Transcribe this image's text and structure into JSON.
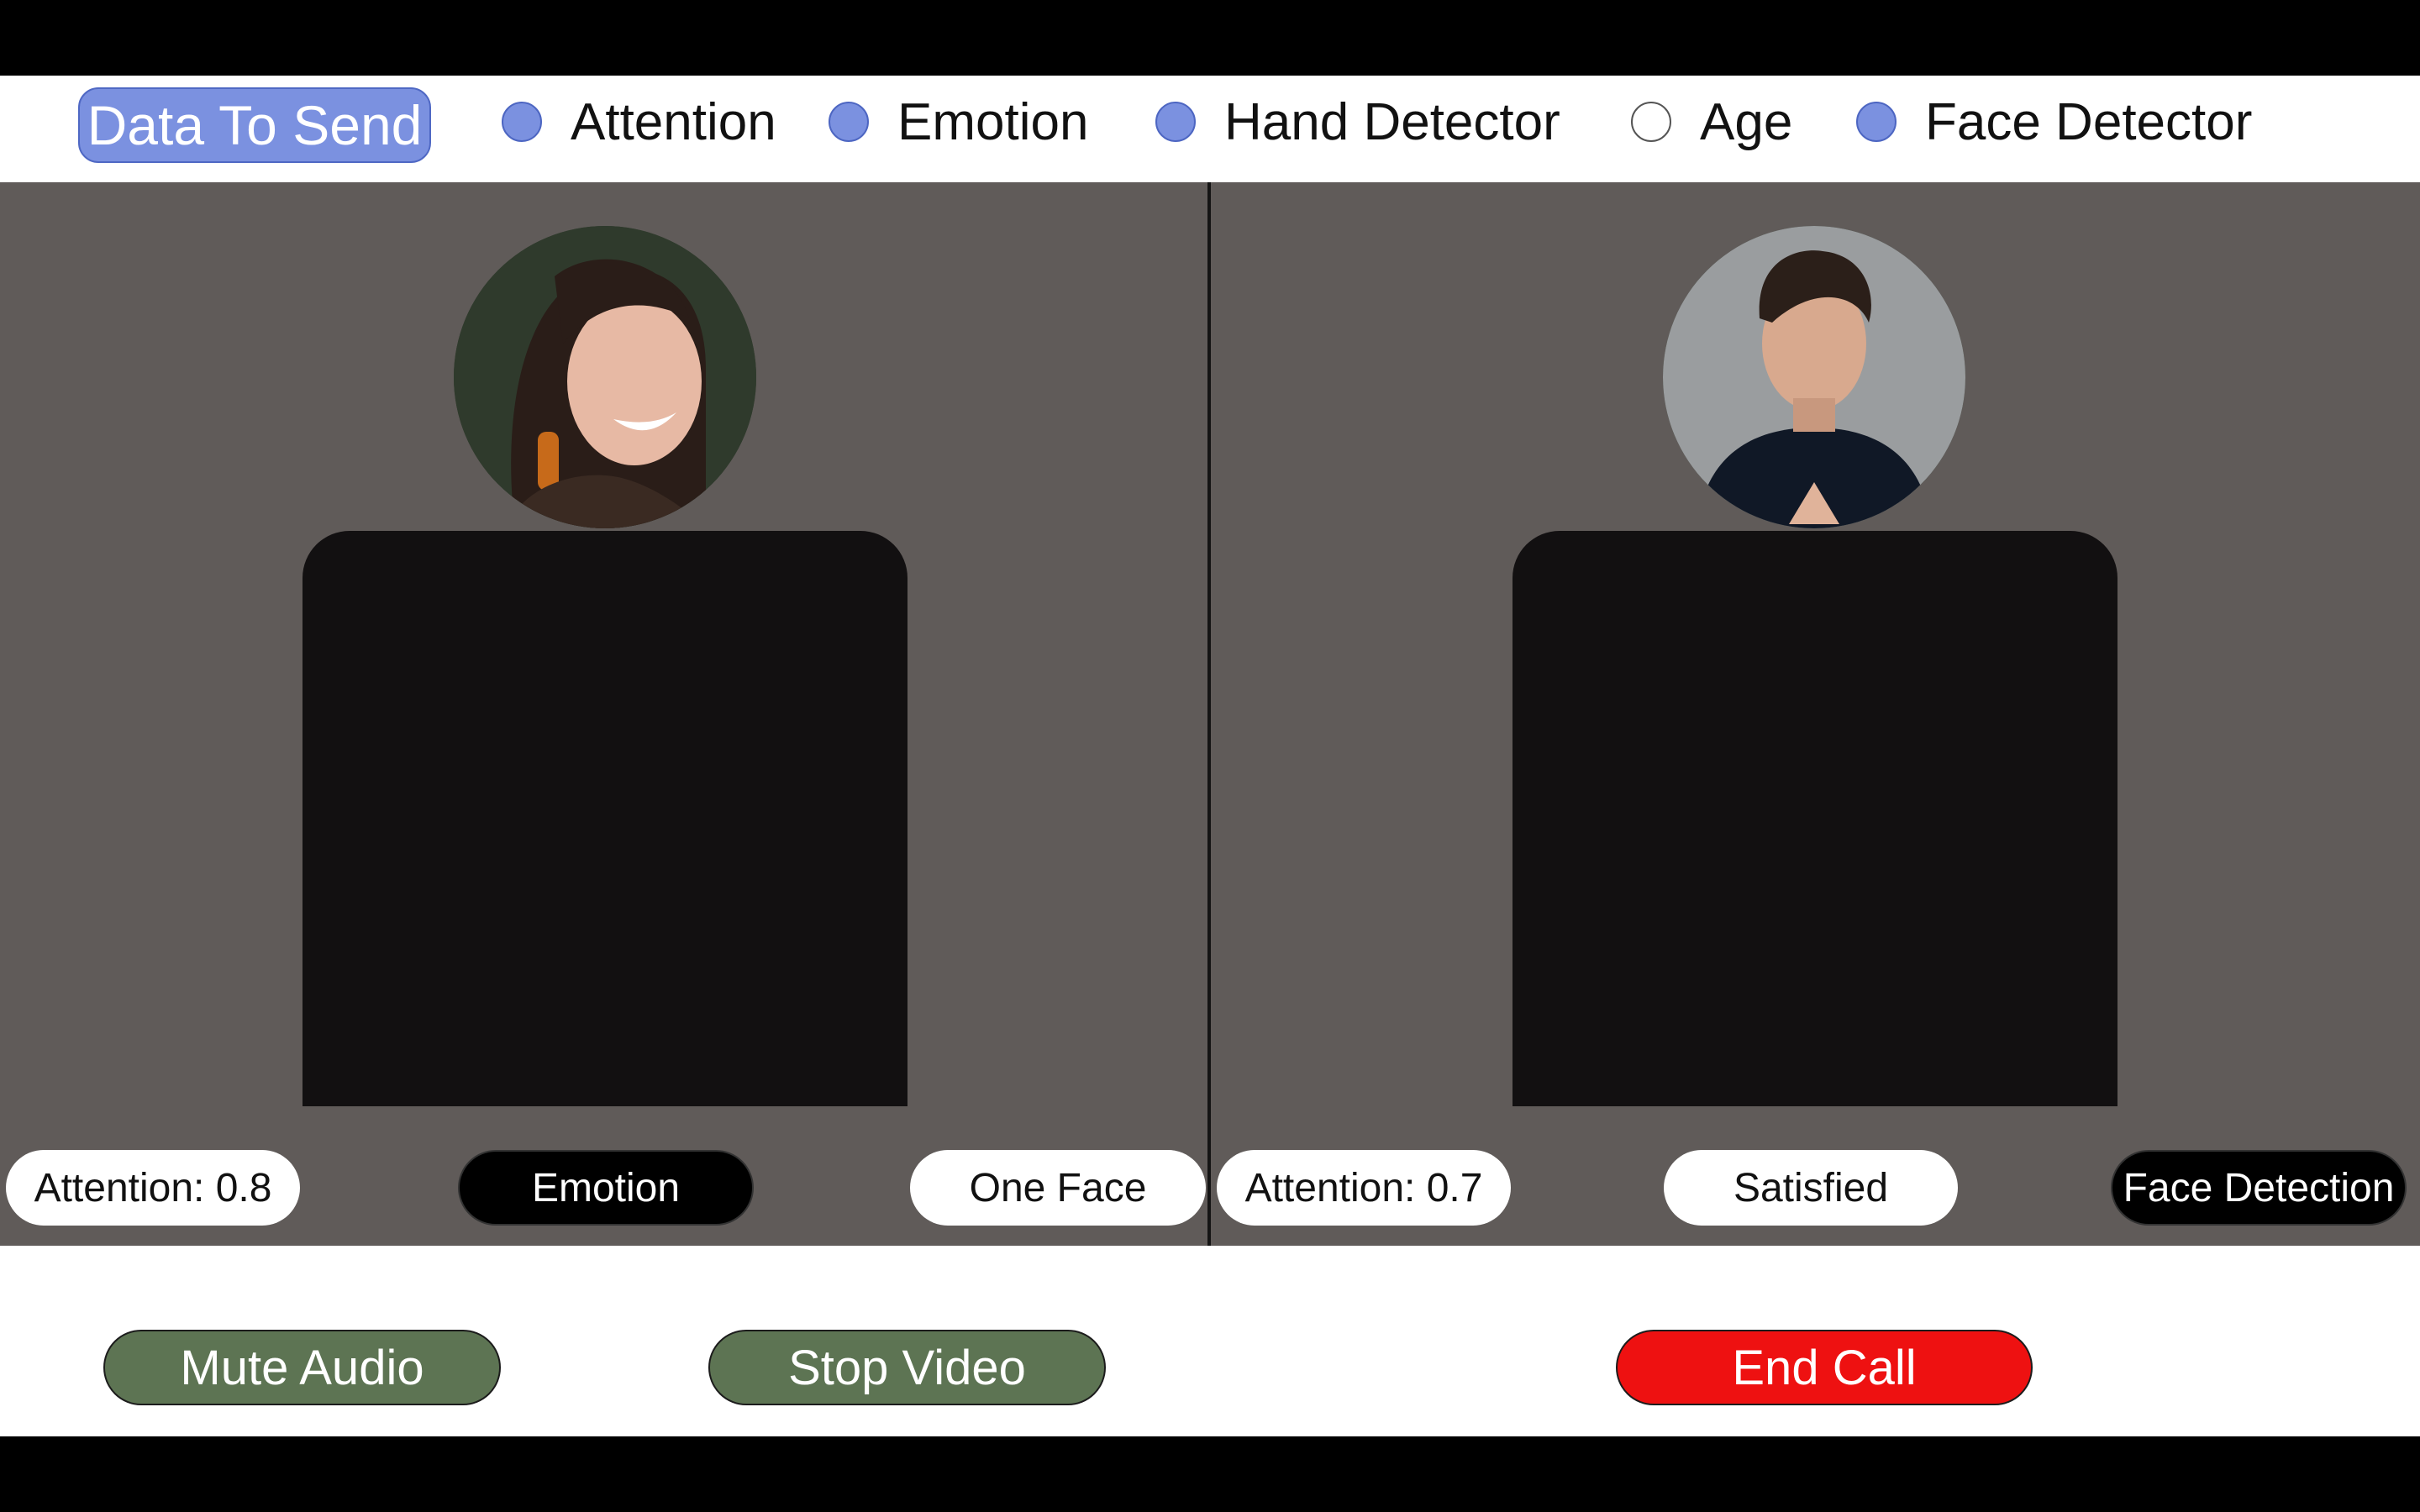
{
  "topbar": {
    "data_button": "Data To Send",
    "options": [
      {
        "label": "Attention",
        "checked": true
      },
      {
        "label": "Emotion",
        "checked": true
      },
      {
        "label": "Hand Detector",
        "checked": true
      },
      {
        "label": "Age",
        "checked": false
      },
      {
        "label": "Face Detector",
        "checked": true
      }
    ]
  },
  "left_participant": {
    "attention": "Attention: 0.8",
    "emotion": "Emotion",
    "face": "One Face"
  },
  "right_participant": {
    "attention": "Attention: 0.7",
    "emotion": "Satisfied",
    "face": "Face Detection"
  },
  "controls": {
    "mute": "Mute Audio",
    "stop_video": "Stop Video",
    "end_call": "End Call"
  },
  "colors": {
    "accent": "#7b91e0",
    "panel": "#605b59",
    "control_green": "#5d7453",
    "end_red": "#ee1111"
  }
}
